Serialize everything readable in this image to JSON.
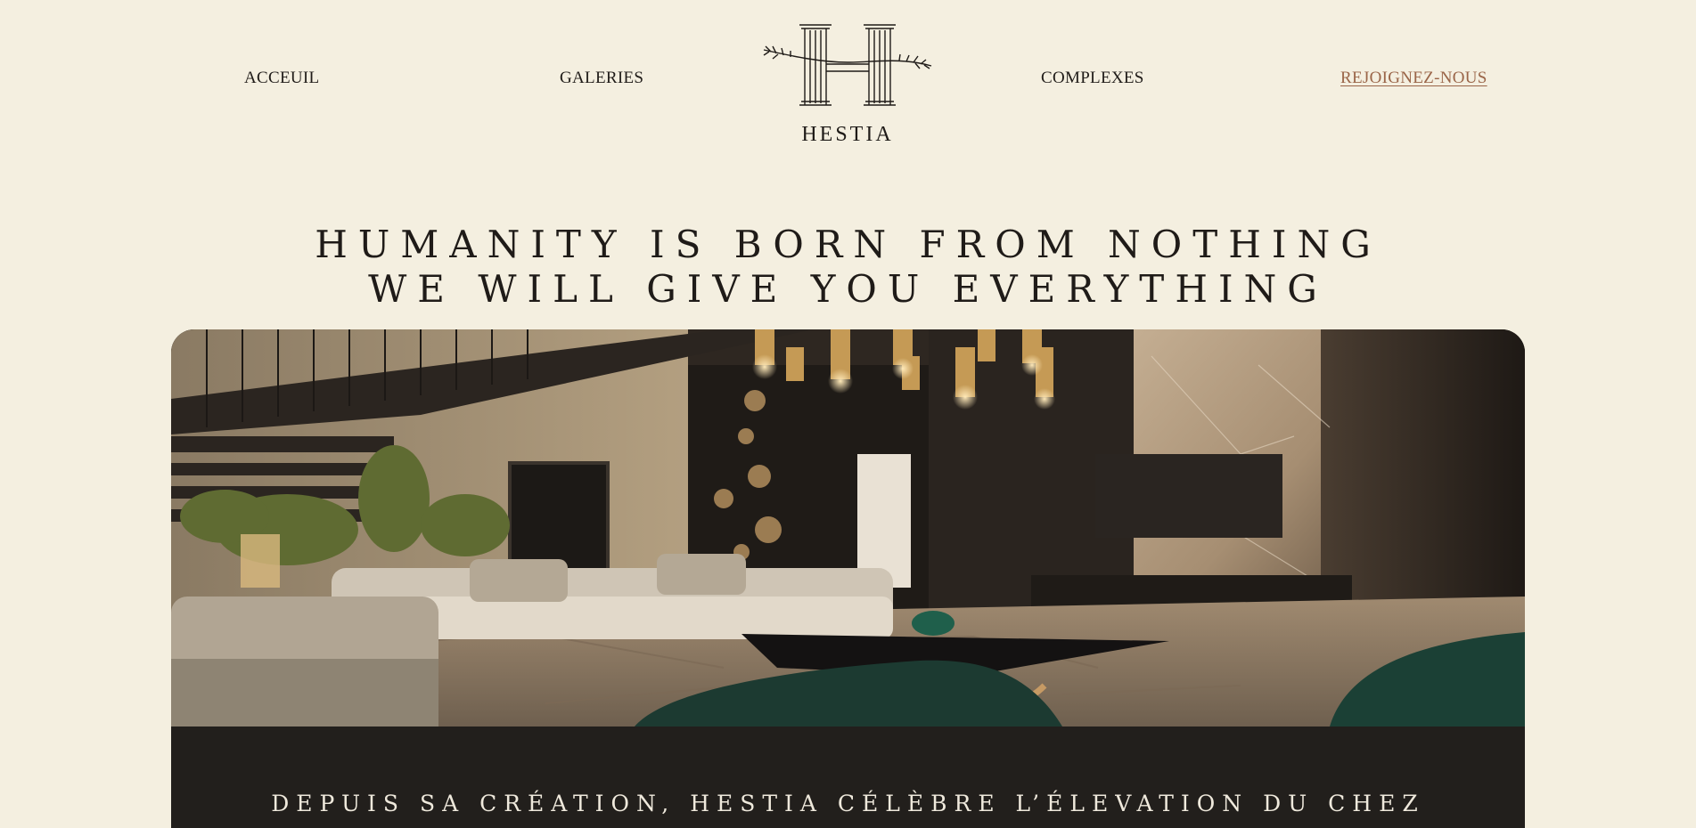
{
  "nav": {
    "items": [
      {
        "label": "ACCEUIL"
      },
      {
        "label": "GALERIES"
      },
      {
        "label": "COMPLEXES"
      },
      {
        "label": "REJOIGNEZ-NOUS",
        "active": true
      }
    ]
  },
  "logo": {
    "brand": "HESTIA",
    "icon": "column-h-laurel-logo"
  },
  "hero": {
    "title_line1": "HUMANITY IS BORN FROM NOTHING",
    "title_line2": "WE WILL GIVE YOU EVERYTHING",
    "image_icon": "luxury-living-room-photo",
    "caption": "DEPUIS SA CRÉATION, HESTIA CÉLÈBRE L’ÉLEVATION DU CHEZ"
  },
  "colors": {
    "background": "#f4efe0",
    "text": "#1f1b18",
    "active_link": "#9a6548",
    "card_dark": "#221f1c"
  }
}
